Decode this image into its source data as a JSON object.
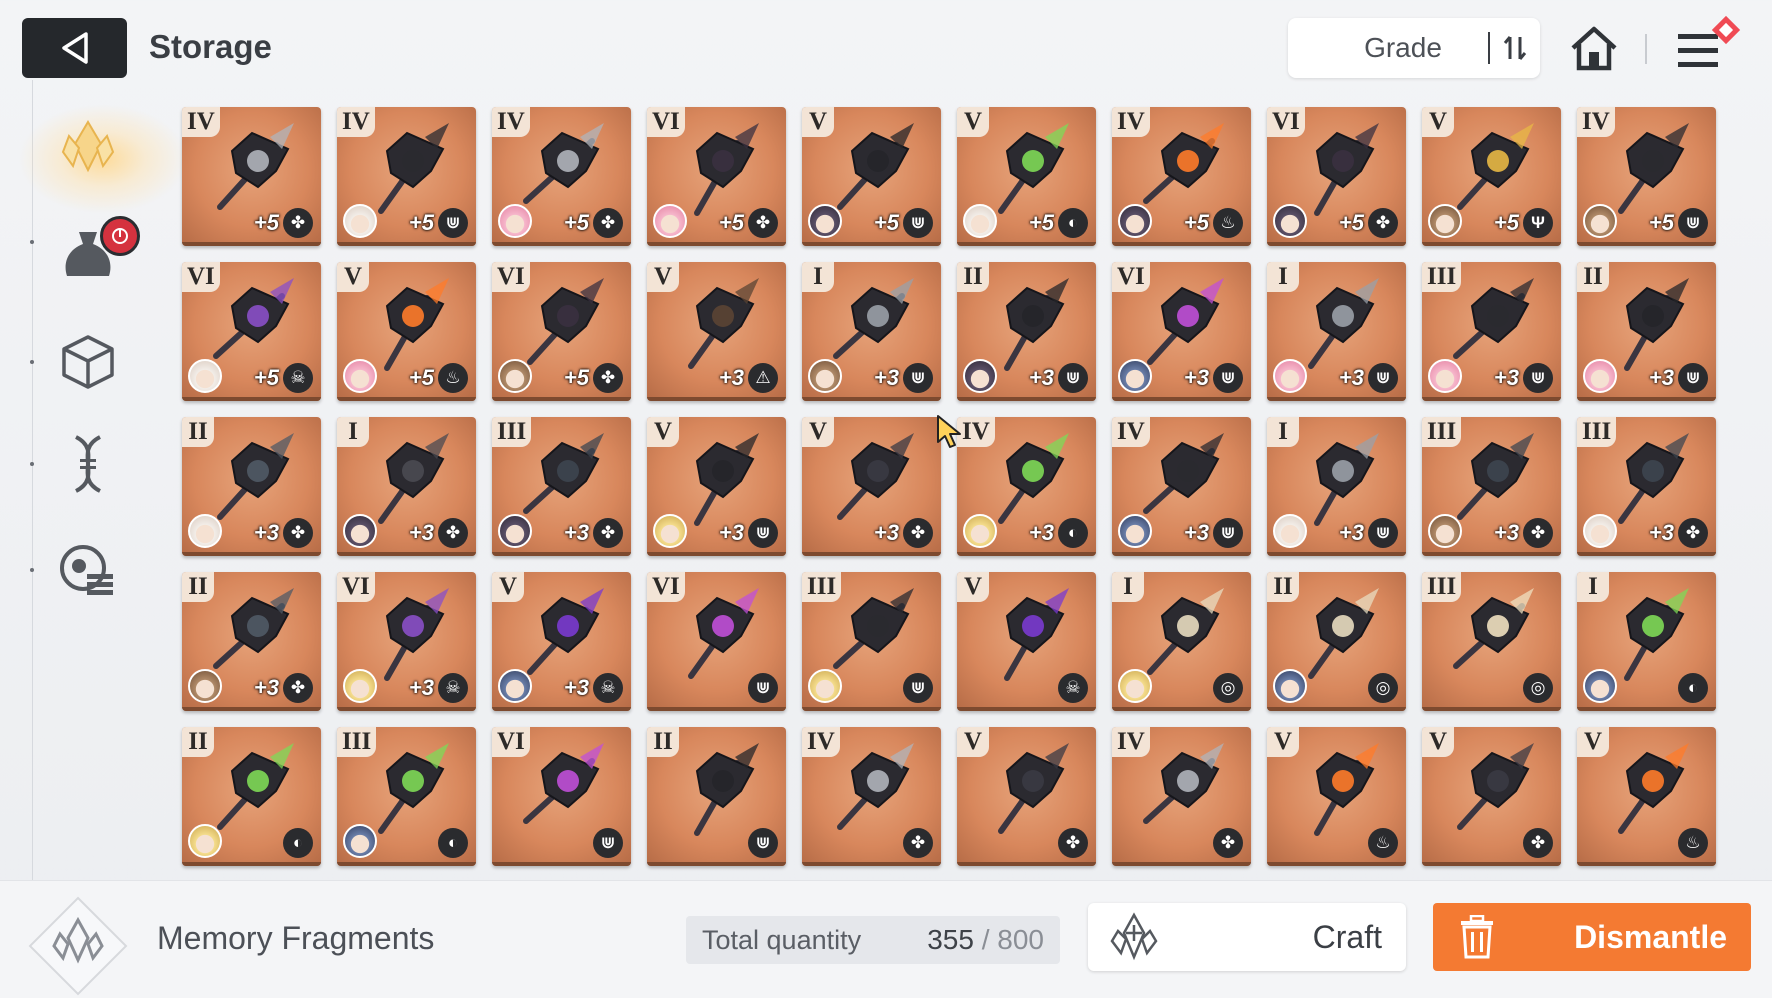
{
  "header": {
    "title": "Storage",
    "sort_label": "Grade"
  },
  "sidebar": {
    "items": [
      {
        "icon": "memory-fragment-icon",
        "active": true
      },
      {
        "icon": "pouch-icon",
        "badge": true
      },
      {
        "icon": "cube-icon"
      },
      {
        "icon": "dna-icon"
      },
      {
        "icon": "settings-list-icon"
      }
    ]
  },
  "colors": {
    "accent_orange": "#f47a32",
    "card_bg": "#d8875c",
    "dark_button": "#25282c"
  },
  "grid": {
    "items": [
      {
        "grade": "IV",
        "plus": "+5",
        "attr": "✤",
        "avatar": "none",
        "hue": "#b0b4bb"
      },
      {
        "grade": "IV",
        "plus": "+5",
        "attr": "⋓",
        "avatar": "white",
        "hue": "#2a2a30"
      },
      {
        "grade": "IV",
        "plus": "+5",
        "attr": "✤",
        "avatar": "pink",
        "hue": "#b0b4bb"
      },
      {
        "grade": "VI",
        "plus": "+5",
        "attr": "✤",
        "avatar": "pink",
        "hue": "#3a3040"
      },
      {
        "grade": "V",
        "plus": "+5",
        "attr": "⋓",
        "avatar": "dark",
        "hue": "#25252a"
      },
      {
        "grade": "V",
        "plus": "+5",
        "attr": "◐",
        "avatar": "white",
        "hue": "#7ed957"
      },
      {
        "grade": "IV",
        "plus": "+5",
        "attr": "♨",
        "avatar": "dark",
        "hue": "#ff7b2a"
      },
      {
        "grade": "VI",
        "plus": "+5",
        "attr": "✤",
        "avatar": "dark",
        "hue": "#3a3040"
      },
      {
        "grade": "V",
        "plus": "+5",
        "attr": "Ψ",
        "avatar": "brown",
        "hue": "#e8b845"
      },
      {
        "grade": "IV",
        "plus": "+5",
        "attr": "⋓",
        "avatar": "brown",
        "hue": "#2a2a30"
      },
      {
        "grade": "VI",
        "plus": "+5",
        "attr": "☠",
        "avatar": "white",
        "hue": "#8a4fc8"
      },
      {
        "grade": "V",
        "plus": "+5",
        "attr": "♨",
        "avatar": "pink",
        "hue": "#ff7b2a"
      },
      {
        "grade": "VI",
        "plus": "+5",
        "attr": "✤",
        "avatar": "brown",
        "hue": "#3a3040"
      },
      {
        "grade": "V",
        "plus": "+3",
        "attr": "⚠",
        "avatar": "none",
        "hue": "#5b4434"
      },
      {
        "grade": "I",
        "plus": "+3",
        "attr": "⋓",
        "avatar": "brown",
        "hue": "#9aa0a8"
      },
      {
        "grade": "II",
        "plus": "+3",
        "attr": "⋓",
        "avatar": "dark",
        "hue": "#25252a"
      },
      {
        "grade": "VI",
        "plus": "+3",
        "attr": "⋓",
        "avatar": "blue",
        "hue": "#c04fd8"
      },
      {
        "grade": "I",
        "plus": "+3",
        "attr": "⋓",
        "avatar": "pink",
        "hue": "#9aa0a8"
      },
      {
        "grade": "III",
        "plus": "+3",
        "attr": "⋓",
        "avatar": "pink",
        "hue": "#2a2a30"
      },
      {
        "grade": "II",
        "plus": "+3",
        "attr": "⋓",
        "avatar": "pink",
        "hue": "#25252a"
      },
      {
        "grade": "II",
        "plus": "+3",
        "attr": "✤",
        "avatar": "white",
        "hue": "#505a66"
      },
      {
        "grade": "I",
        "plus": "+3",
        "attr": "✤",
        "avatar": "dark",
        "hue": "#4a4a52"
      },
      {
        "grade": "III",
        "plus": "+3",
        "attr": "✤",
        "avatar": "dark",
        "hue": "#3d4550"
      },
      {
        "grade": "V",
        "plus": "+3",
        "attr": "⋓",
        "avatar": "blonde",
        "hue": "#25252a"
      },
      {
        "grade": "V",
        "plus": "+3",
        "attr": "✤",
        "avatar": "none",
        "hue": "#3a3a44"
      },
      {
        "grade": "IV",
        "plus": "+3",
        "attr": "◐",
        "avatar": "blonde",
        "hue": "#7ed957"
      },
      {
        "grade": "IV",
        "plus": "+3",
        "attr": "⋓",
        "avatar": "blue",
        "hue": "#2a2a30"
      },
      {
        "grade": "I",
        "plus": "+3",
        "attr": "⋓",
        "avatar": "white",
        "hue": "#9aa0a8"
      },
      {
        "grade": "III",
        "plus": "+3",
        "attr": "✤",
        "avatar": "brown",
        "hue": "#3d4550"
      },
      {
        "grade": "III",
        "plus": "+3",
        "attr": "✤",
        "avatar": "white",
        "hue": "#3d4550"
      },
      {
        "grade": "II",
        "plus": "+3",
        "attr": "✤",
        "avatar": "brown",
        "hue": "#505a66"
      },
      {
        "grade": "VI",
        "plus": "+3",
        "attr": "☠",
        "avatar": "blonde",
        "hue": "#8a4fc8"
      },
      {
        "grade": "V",
        "plus": "+3",
        "attr": "☠",
        "avatar": "blue",
        "hue": "#7a3ad0"
      },
      {
        "grade": "VI",
        "plus": "",
        "attr": "⋓",
        "avatar": "none",
        "hue": "#c04fd8"
      },
      {
        "grade": "III",
        "plus": "",
        "attr": "⋓",
        "avatar": "blonde",
        "hue": "#2a2a30"
      },
      {
        "grade": "V",
        "plus": "",
        "attr": "☠",
        "avatar": "none",
        "hue": "#7a3ad0"
      },
      {
        "grade": "I",
        "plus": "",
        "attr": "◎",
        "avatar": "blonde",
        "hue": "#e8dcc0"
      },
      {
        "grade": "II",
        "plus": "",
        "attr": "◎",
        "avatar": "blue",
        "hue": "#e8dcc0"
      },
      {
        "grade": "III",
        "plus": "",
        "attr": "◎",
        "avatar": "none",
        "hue": "#efe0c0"
      },
      {
        "grade": "I",
        "plus": "",
        "attr": "◐",
        "avatar": "blue",
        "hue": "#7ed957"
      },
      {
        "grade": "II",
        "plus": "",
        "attr": "◐",
        "avatar": "blonde",
        "hue": "#7ed957"
      },
      {
        "grade": "III",
        "plus": "",
        "attr": "◐",
        "avatar": "blue",
        "hue": "#7ed957"
      },
      {
        "grade": "VI",
        "plus": "",
        "attr": "⋓",
        "avatar": "none",
        "hue": "#c04fd8"
      },
      {
        "grade": "II",
        "plus": "",
        "attr": "⋓",
        "avatar": "none",
        "hue": "#25252a"
      },
      {
        "grade": "IV",
        "plus": "",
        "attr": "✤",
        "avatar": "none",
        "hue": "#b0b4bb"
      },
      {
        "grade": "V",
        "plus": "",
        "attr": "✤",
        "avatar": "none",
        "hue": "#3a3a44"
      },
      {
        "grade": "IV",
        "plus": "",
        "attr": "✤",
        "avatar": "none",
        "hue": "#b0b4bb"
      },
      {
        "grade": "V",
        "plus": "",
        "attr": "♨",
        "avatar": "none",
        "hue": "#ff7b2a"
      },
      {
        "grade": "V",
        "plus": "",
        "attr": "✤",
        "avatar": "none",
        "hue": "#3a3a44"
      },
      {
        "grade": "V",
        "plus": "",
        "attr": "♨",
        "avatar": "none",
        "hue": "#ff7b2a"
      }
    ]
  },
  "footer": {
    "category_label": "Memory Fragments",
    "total_label": "Total quantity",
    "total_current": "355",
    "total_sep": " / ",
    "total_max": "800",
    "craft_label": "Craft",
    "dismantle_label": "Dismantle"
  }
}
